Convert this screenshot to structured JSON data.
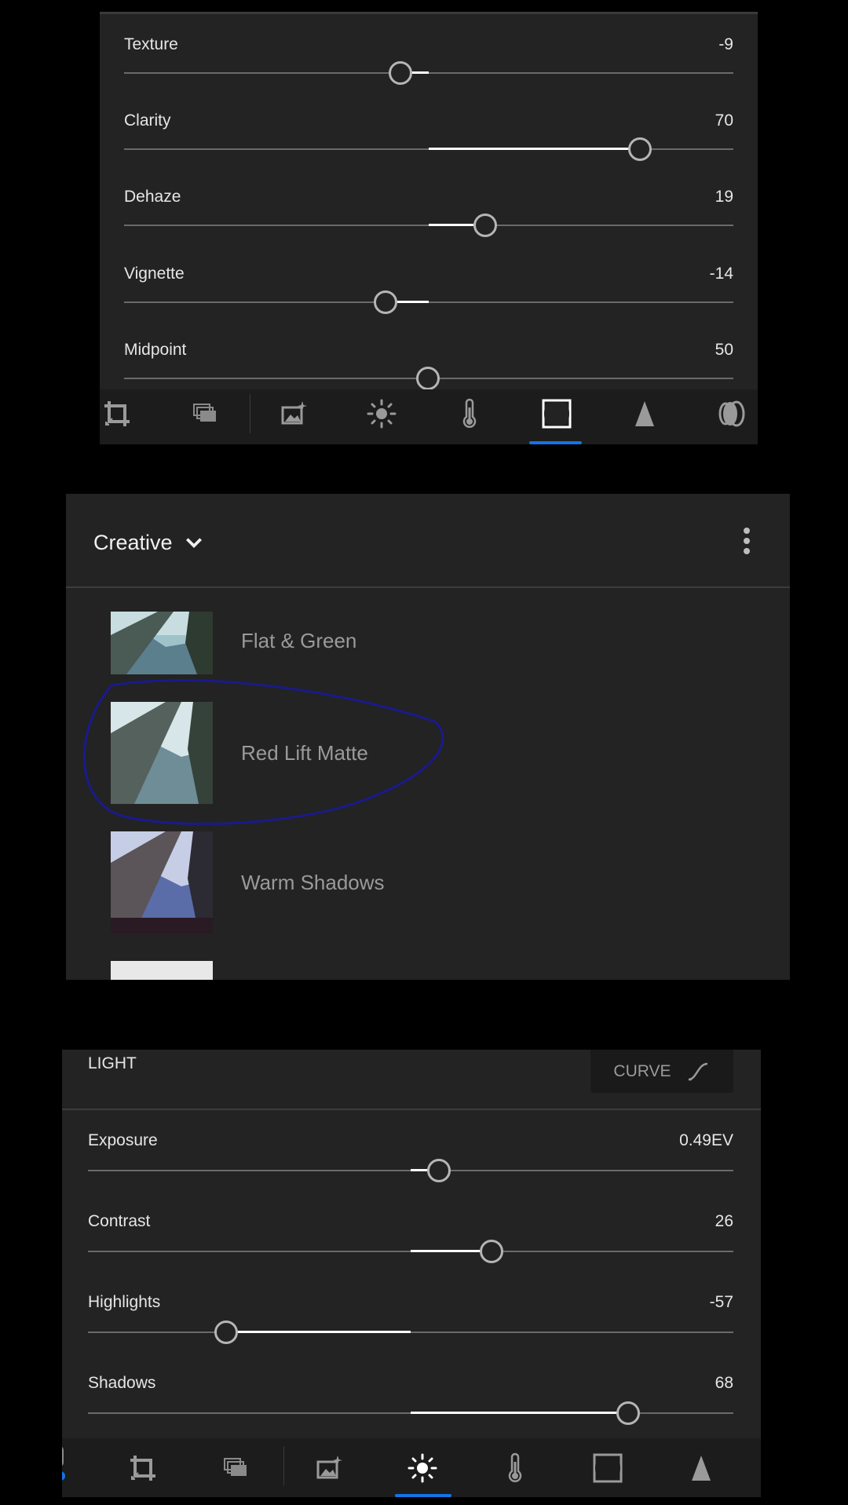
{
  "panel1": {
    "sliders": [
      {
        "label": "Texture",
        "value": "-9",
        "level": -9
      },
      {
        "label": "Clarity",
        "value": "70",
        "level": 70
      },
      {
        "label": "Dehaze",
        "value": "19",
        "level": 19
      },
      {
        "label": "Vignette",
        "value": "-14",
        "level": -14
      },
      {
        "label": "Midpoint",
        "value": "50",
        "level": 50
      }
    ],
    "toolbar": {
      "tools": [
        "crop-icon",
        "versions-icon",
        "auto-enhance-icon",
        "light-icon",
        "color-temperature-icon",
        "effects-icon",
        "detail-icon",
        "optics-icon"
      ],
      "active": "effects-icon"
    }
  },
  "panel2": {
    "group_title": "Creative",
    "presets": [
      {
        "name": "Flat & Green"
      },
      {
        "name": "Red Lift Matte"
      },
      {
        "name": "Warm Shadows"
      }
    ]
  },
  "panel3": {
    "section_title": "LIGHT",
    "curve_label": "CURVE",
    "sliders": [
      {
        "label": "Exposure",
        "value": "0.49EV",
        "level": 0.49
      },
      {
        "label": "Contrast",
        "value": "26",
        "level": 26
      },
      {
        "label": "Highlights",
        "value": "-57",
        "level": -57
      },
      {
        "label": "Shadows",
        "value": "68",
        "level": 68
      }
    ],
    "toolbar": {
      "tools": [
        "crop-icon",
        "versions-icon",
        "auto-enhance-icon",
        "light-icon",
        "color-temperature-icon",
        "effects-icon",
        "detail-icon"
      ],
      "active": "light-icon"
    }
  },
  "colors": {
    "accent": "#1473e6",
    "panel": "#232323",
    "annotation": "#1a1a8c"
  }
}
